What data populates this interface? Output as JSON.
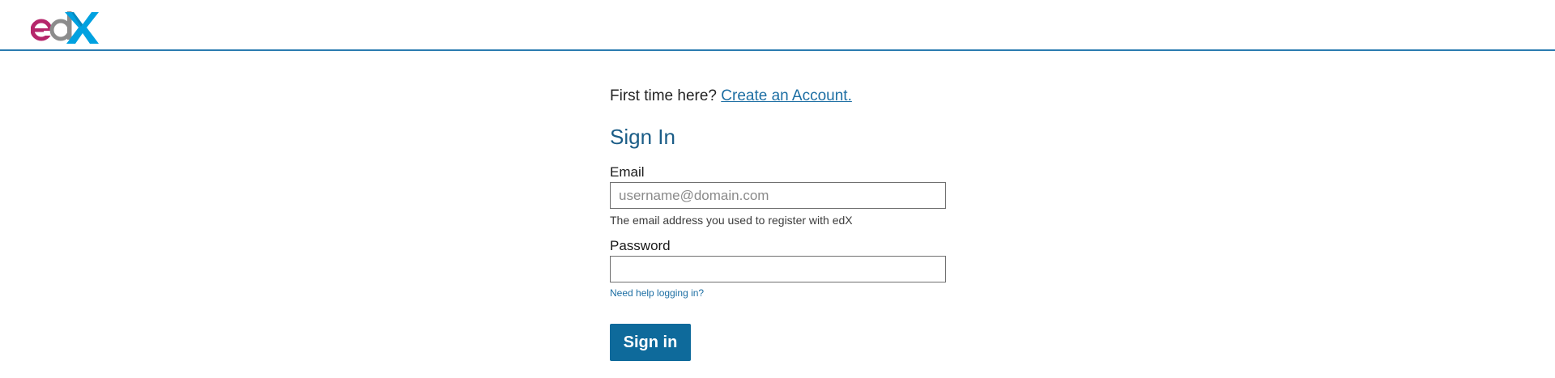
{
  "header": {
    "logo_text": "edX",
    "brand_colors": {
      "e": "#b5266b",
      "d": "#8c8c8c",
      "x": "#00a1e0"
    }
  },
  "account_prompt": {
    "text": "First time here?",
    "link_label": "Create an Account."
  },
  "signin": {
    "title": "Sign In",
    "email_label": "Email",
    "email_placeholder": "username@domain.com",
    "email_value": "",
    "email_help": "The email address you used to register with edX",
    "password_label": "Password",
    "password_value": "",
    "help_link": "Need help logging in?",
    "button_label": "Sign in"
  },
  "colors": {
    "header_border": "#2a7bb0",
    "title": "#1b5d87",
    "link": "#1c6ea3",
    "button": "#0e6a9b"
  }
}
